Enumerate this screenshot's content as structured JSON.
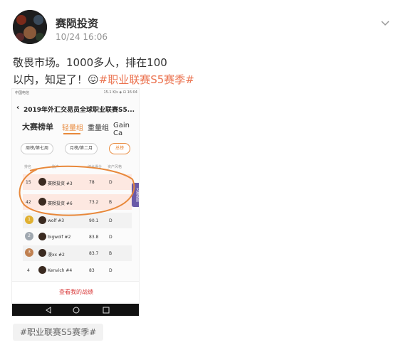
{
  "post": {
    "author": "赛陨投资",
    "timestamp": "10/24 16:06",
    "text_line1": "敬畏市场。1000多人，排在100",
    "text_line2_prefix": "以内，知足了！",
    "emoji": "😖",
    "topic": "#职业联赛S5赛季#"
  },
  "phone": {
    "status_left": "中国电信",
    "status_right": "15.1 K/s  ◈  ⊡  16:04",
    "title": "2019年外汇交易员全球职业联赛S5...",
    "tabs": [
      "大赛榜单",
      "轻量组",
      "重量组",
      "Gain Ca"
    ],
    "filters": [
      "周榜/第七周",
      "月榜/第二月",
      "总榜"
    ],
    "headers": [
      "排名",
      "账户",
      "综合得分",
      "资产风格"
    ],
    "rows": [
      {
        "rank": "15",
        "name": "赛陨投资 #3",
        "score": "78",
        "style": "D"
      },
      {
        "rank": "42",
        "name": "赛陨投资 #6",
        "score": "73.2",
        "style": "B"
      },
      {
        "rank": "1",
        "name": "wolf #3",
        "score": "90.1",
        "style": "D"
      },
      {
        "rank": "2",
        "name": "bigwolf #2",
        "score": "83.8",
        "style": "D"
      },
      {
        "rank": "3",
        "name": "漫xx #2",
        "score": "83.7",
        "style": "B"
      },
      {
        "rank": "4",
        "name": "Kenvich #4",
        "score": "83",
        "style": "D"
      }
    ],
    "side_tag": "大赛规则",
    "cta": "查看我的战绩"
  },
  "tag_chip": "#职业联赛S5赛季#",
  "colors": {
    "topic": "#eb7350",
    "highlight": "#fde8e1",
    "circle": "#e8883a"
  }
}
